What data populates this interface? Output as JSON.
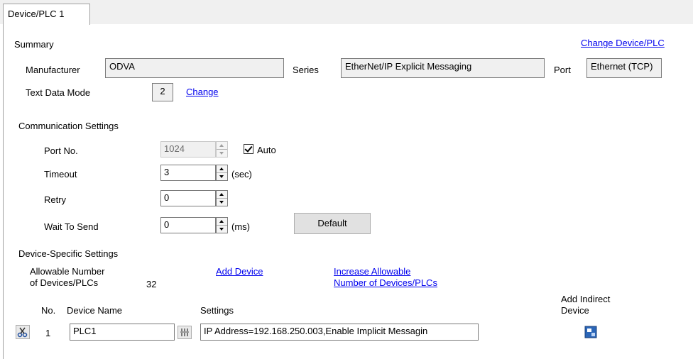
{
  "tab": {
    "label": "Device/PLC 1"
  },
  "summary": {
    "heading": "Summary",
    "change_link": "Change Device/PLC",
    "manufacturer_label": "Manufacturer",
    "manufacturer_value": "ODVA",
    "series_label": "Series",
    "series_value": "EtherNet/IP Explicit Messaging",
    "port_label": "Port",
    "port_value": "Ethernet (TCP)",
    "text_mode_label": "Text Data Mode",
    "text_mode_value": "2",
    "text_mode_change": "Change"
  },
  "comm": {
    "heading": "Communication Settings",
    "port_label": "Port No.",
    "port_value": "1024",
    "auto_label": "Auto",
    "timeout_label": "Timeout",
    "timeout_value": "3",
    "timeout_unit": "(sec)",
    "retry_label": "Retry",
    "retry_value": "0",
    "wait_label": "Wait To Send",
    "wait_value": "0",
    "wait_unit": "(ms)",
    "default_button": "Default"
  },
  "device": {
    "heading": "Device-Specific Settings",
    "allowable_label_1": "Allowable Number",
    "allowable_label_2": "of Devices/PLCs",
    "allowable_value": "32",
    "add_device_link": "Add Device",
    "increase_link_1": "Increase Allowable",
    "increase_link_2": "Number of Devices/PLCs",
    "col_no": "No.",
    "col_name": "Device Name",
    "col_settings": "Settings",
    "col_indirect_1": "Add Indirect",
    "col_indirect_2": "Device",
    "rows": [
      {
        "no": "1",
        "name": "PLC1",
        "settings": "IP Address=192.168.250.003,Enable Implicit Messagin"
      }
    ]
  }
}
